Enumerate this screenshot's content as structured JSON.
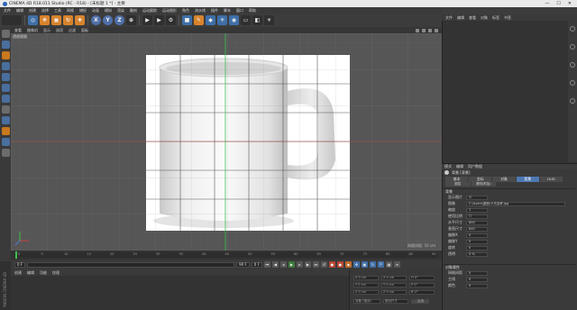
{
  "window": {
    "title": "CINEMA 4D R18.011 Studio (RC - R18) - [未标题 1 *] - 主要",
    "controls": [
      "—",
      "☐",
      "✕"
    ]
  },
  "menubar": [
    "文件",
    "编辑",
    "创建",
    "选择",
    "工具",
    "网格",
    "捕捉",
    "动画",
    "模拟",
    "渲染",
    "雕刻",
    "运动跟踪",
    "运动图形",
    "角色",
    "流水线",
    "插件",
    "脚本",
    "窗口",
    "帮助"
  ],
  "toolbar": {
    "axis_buttons": [
      "X",
      "Y",
      "Z"
    ]
  },
  "viewport": {
    "menu": [
      "查看",
      "摄像机",
      "显示",
      "选项",
      "过滤",
      "面板"
    ],
    "camera_label": "透视视图",
    "grid_info": "网格间距: 10 cm",
    "accent_colors": {
      "y_axis": "#3fbf4e",
      "x_axis": "#c8423a"
    }
  },
  "timeline": {
    "ticks": [
      "0",
      "5",
      "10",
      "15",
      "20",
      "25",
      "30",
      "35",
      "40",
      "45",
      "50",
      "55",
      "60",
      "65",
      "70",
      "75",
      "80",
      "85",
      "90"
    ],
    "start_field": "0 F",
    "end_field": "90 F",
    "current_frame": "0 F"
  },
  "material_manager": {
    "menu": [
      "创建",
      "编辑",
      "功能",
      "纹理"
    ]
  },
  "coord_manager": {
    "rows": [
      [
        "X 0 cm",
        "X 0 cm",
        "H 0°"
      ],
      [
        "Y 0 cm",
        "Y 0 cm",
        "P 0°"
      ],
      [
        "Z 0 cm",
        "Z 0 cm",
        "B 0°"
      ]
    ],
    "mode": "对象 (相对)",
    "size_mode": "绝对尺寸",
    "apply": "应用"
  },
  "object_manager": {
    "menu": [
      "文件",
      "编辑",
      "查看",
      "对象",
      "标签",
      "书签"
    ]
  },
  "attributes": {
    "menu": [
      "模式",
      "编辑",
      "用户数据"
    ],
    "title": "背景 [背景]",
    "tabs": [
      "基本",
      "坐标",
      "对象",
      "背景",
      "HUD"
    ],
    "active_tab": "背景",
    "subtabs": [
      "图层",
      "透明(附加)"
    ],
    "section_header": "背景",
    "rows": [
      {
        "label": "显示图片",
        "value": "☑"
      },
      {
        "label": "图像",
        "value": "C:\\Users\\桌面\\1\\马克杯.jpg"
      },
      {
        "label": "缩放",
        "value": "1"
      },
      {
        "label": "使用比例",
        "value": "☐"
      },
      {
        "label": "水平尺寸",
        "value": "800"
      },
      {
        "label": "垂直尺寸",
        "value": "640"
      },
      {
        "label": "偏移X",
        "value": "0"
      },
      {
        "label": "偏移Y",
        "value": "0"
      },
      {
        "label": "旋转",
        "value": "0"
      },
      {
        "label": "透明",
        "value": "0 %"
      }
    ],
    "second_section": "对象属性",
    "second_rows": [
      {
        "label": "网格间距",
        "value": "0"
      },
      {
        "label": "主线",
        "value": "0"
      },
      {
        "label": "颜色",
        "value": "0"
      }
    ]
  }
}
